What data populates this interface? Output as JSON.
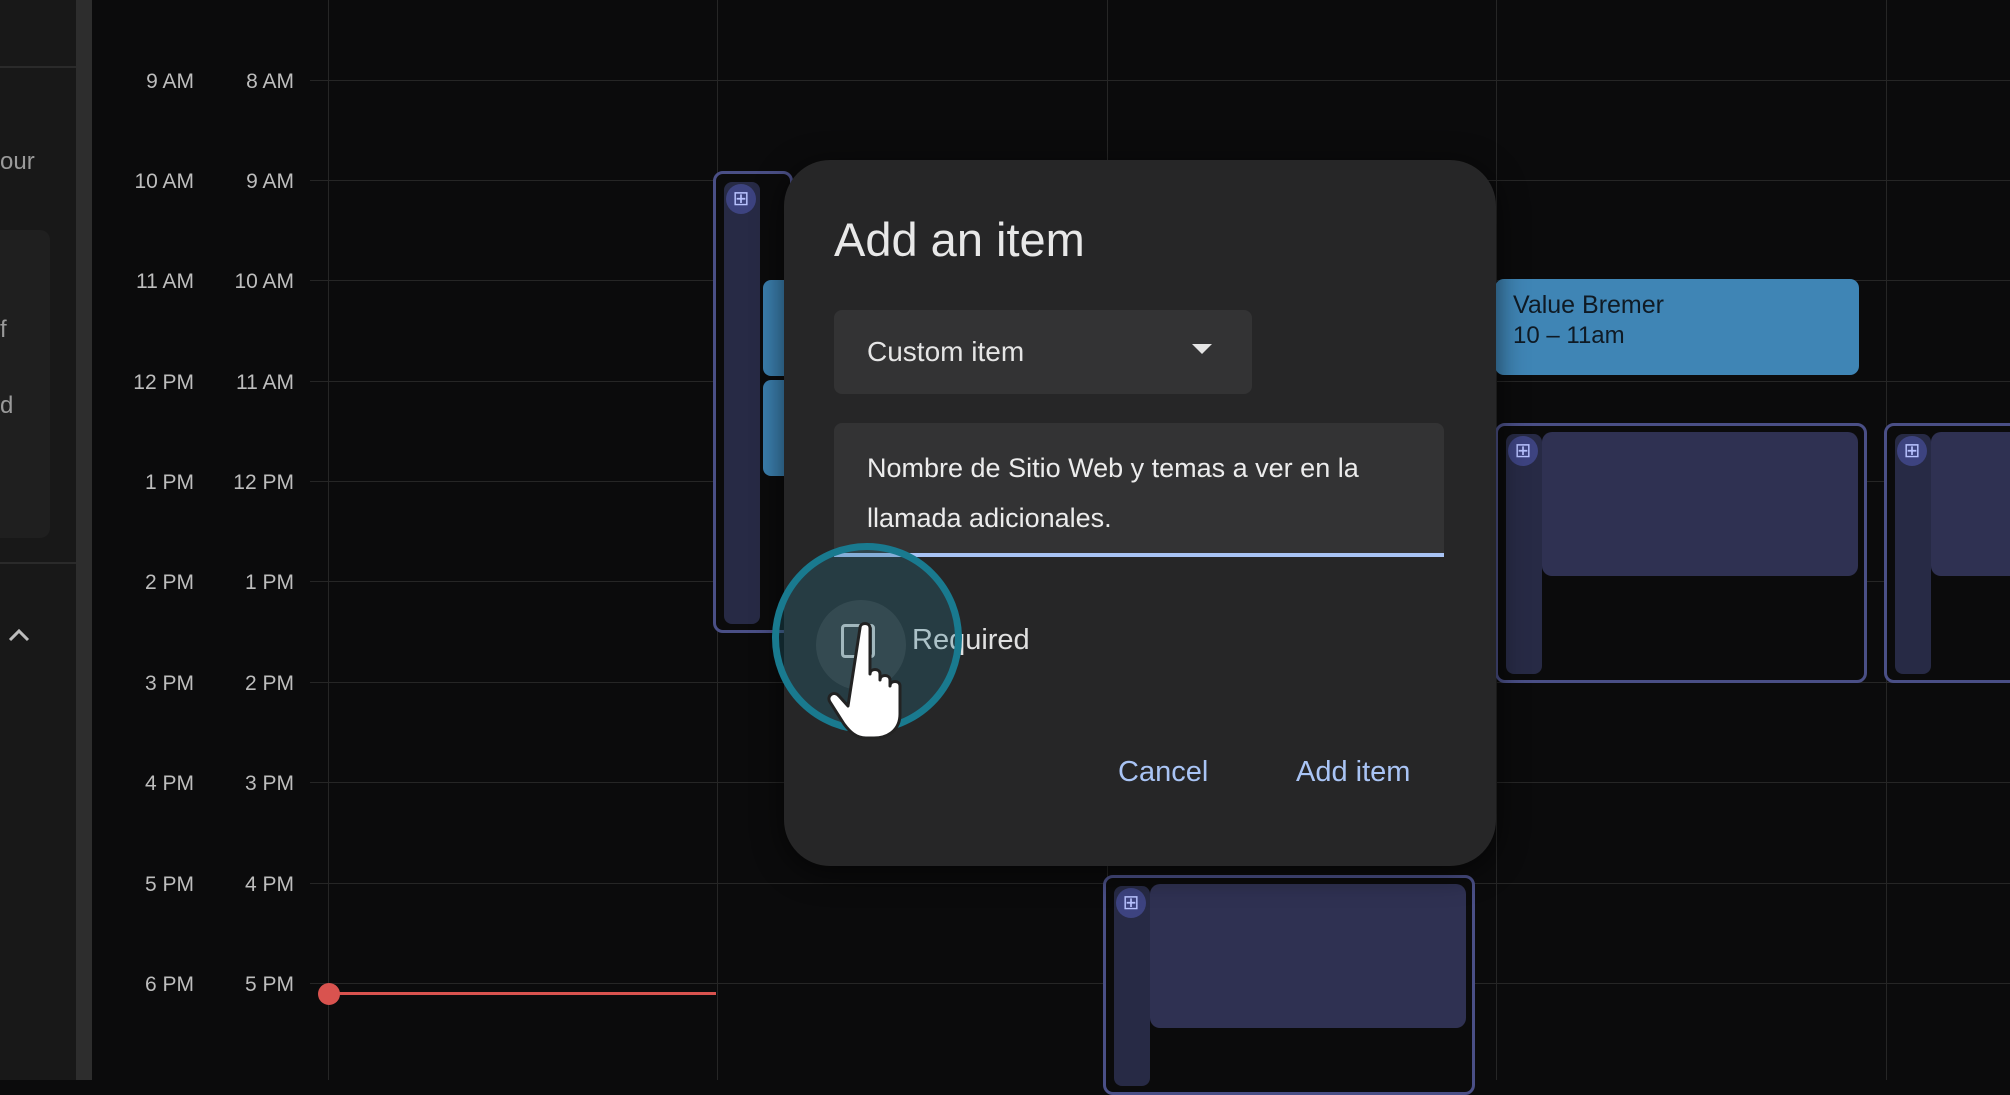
{
  "sidebar": {
    "snippets": [
      "our",
      "f",
      "d"
    ]
  },
  "time_column_primary": [
    "9 AM",
    "10 AM",
    "11 AM",
    "12 PM",
    "1 PM",
    "2 PM",
    "3 PM",
    "4 PM",
    "5 PM",
    "6 PM"
  ],
  "time_column_secondary": [
    "8 AM",
    "9 AM",
    "10 AM",
    "11 AM",
    "12 PM",
    "1 PM",
    "2 PM",
    "3 PM",
    "4 PM",
    "5 PM"
  ],
  "event": {
    "title": "Value Bremer",
    "time": "10 – 11am"
  },
  "dialog": {
    "title": "Add an item",
    "type_select": {
      "value": "Custom item"
    },
    "item_text": "Nombre de Sitio Web y temas a ver en la llamada adicionales.",
    "required_label": "Required",
    "required_checked": false,
    "cancel_label": "Cancel",
    "add_label": "Add item"
  },
  "colors": {
    "accent": "#a9c4f5",
    "event_blue": "#3f85b5",
    "now_indicator": "#d9534f",
    "dialog_bg": "#262627"
  }
}
